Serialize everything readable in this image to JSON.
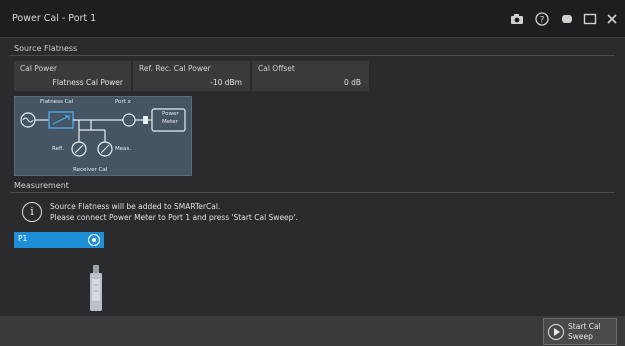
{
  "window": {
    "title": "Power Cal - Port 1"
  },
  "toolbar": {
    "icons": [
      "camera-icon",
      "help-icon",
      "restore-icon",
      "maximize-icon",
      "close-icon"
    ]
  },
  "source_flatness": {
    "section_title": "Source Flatness",
    "fields": [
      {
        "label": "Cal Power",
        "value": "Flatness Cal Power"
      },
      {
        "label": "Ref. Rec. Cal Power",
        "value": "-10 dBm"
      },
      {
        "label": "Cal Offset",
        "value": "0 dB"
      }
    ],
    "diagram": {
      "flatness_cal": "Flatness Cal",
      "port": "Port x",
      "power_meter_line1": "Power",
      "power_meter_line2": "Meter",
      "refl": "Refl.",
      "meas": "Meas.",
      "receiver_cal": "Receiver Cal"
    }
  },
  "measurement": {
    "section_title": "Measurement",
    "message_line1": "Source Flatness will be added to SMARTerCal.",
    "message_line2": "Please connect Power Meter to Port 1 and press 'Start Cal Sweep'.",
    "port_label": "P1"
  },
  "footer": {
    "start_line1": "Start Cal",
    "start_line2": "Sweep"
  },
  "colors": {
    "accent": "#1e8fd6",
    "background": "#2b2b2d",
    "diagram_bg": "#465564"
  }
}
